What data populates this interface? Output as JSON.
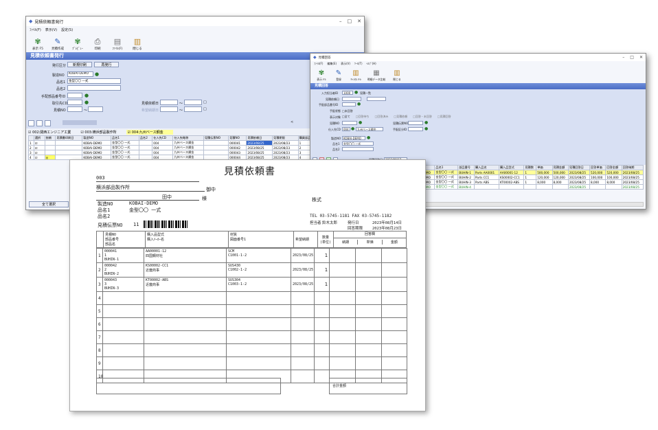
{
  "win1": {
    "title": "見積依頼書発行",
    "menu": [
      "ﾌｧｲﾙ(F)",
      "表示(V)",
      "設定(S)"
    ],
    "tools": [
      {
        "label": "表示 F5",
        "icon": "display-icon"
      },
      {
        "label": "見積作成",
        "icon": "create-icon"
      },
      {
        "label": "ﾌﾟﾚﾋﾞｭｰ",
        "icon": "preview-icon"
      },
      {
        "label": "印刷",
        "icon": "print-icon"
      },
      {
        "label": "ﾌｧｲﾙ(F)",
        "icon": "file-icon"
      },
      {
        "label": "閉じる",
        "icon": "close-icon"
      }
    ],
    "heading": "見積依頼書発行",
    "form": {
      "kind_label": "発行区分",
      "new_btn": "新規印刷",
      "reprint_btn": "再発行",
      "seizo_label": "製造NO",
      "seizo_val": "KOBAI-DEMO",
      "hin1_label": "品名1",
      "hin1_val": "金型〇〇 一式",
      "hin2_label": "品名2",
      "hin2_val": "",
      "tehai_label": "手配部品番号ID",
      "tori_label": "取引先CD",
      "mitsu_label": "見積NO",
      "mdate_label": "見積依頼日",
      "kdate_label": "希望納期日",
      "tilde": "～",
      "cal": "□"
    },
    "filters": [
      {
        "label": "002:関西エンジニア工業",
        "checked": true,
        "hl": false
      },
      {
        "label": "003:横浜部品製作所",
        "checked": true,
        "hl": false
      },
      {
        "label": "004:九州ベース鋼金",
        "checked": true,
        "hl": true
      }
    ],
    "scroll_left": "<",
    "columns": [
      "",
      "選択",
      "依頼",
      "見積書印刷日",
      "製造NO",
      "品名1",
      "品名2",
      "仕入先CD",
      "仕入先略称",
      "見積伝票NO",
      "見積NO",
      "見積依頼日",
      "見積期限",
      "購買部品NO",
      "部品番号",
      "部品名"
    ],
    "rows": [
      {
        "n": "1",
        "sel": "☑",
        "flag": "",
        "date": "",
        "seizo": "KOBAI-DEMO",
        "h1": "金型〇〇 一式",
        "h2": "",
        "cd": "004",
        "name": "九州ベース鋼金",
        "den": "",
        "no": "000041",
        "md": "2023/08/25",
        "kg": "2023/08/23",
        "bno": "1",
        "bb": "1",
        "bname": "BUHIN-1",
        "hl": true
      },
      {
        "n": "2",
        "sel": "☑",
        "flag": "",
        "date": "",
        "seizo": "KOBAI-DEMO",
        "h1": "金型〇〇 一式",
        "h2": "",
        "cd": "004",
        "name": "九州ベース鋼金",
        "den": "",
        "no": "000042",
        "md": "2023/08/25",
        "kg": "2023/08/23",
        "bno": "2",
        "bb": "2",
        "bname": "BUHIN-2",
        "hl": false
      },
      {
        "n": "3",
        "sel": "☑",
        "flag": "",
        "date": "",
        "seizo": "KOBAI-DEMO",
        "h1": "金型〇〇 一式",
        "h2": "",
        "cd": "004",
        "name": "九州ベース鋼金",
        "den": "",
        "no": "000043",
        "md": "2023/08/25",
        "kg": "2023/08/23",
        "bno": "3",
        "bb": "3",
        "bname": "BUHIN-3",
        "hl": false
      },
      {
        "n": "4",
        "sel": "☑",
        "flag": "◎",
        "date": "",
        "seizo": "KOBAI-DEMO",
        "h1": "金型〇〇 一式",
        "h2": "",
        "cd": "004",
        "name": "九州ベース鋼金",
        "den": "",
        "no": "000044",
        "md": "2023/08/25",
        "kg": "2023/08/23",
        "bno": "4",
        "bb": "0",
        "bname": "BUHIN-4",
        "hl": false
      }
    ],
    "select_all": "全て選択"
  },
  "win2": {
    "title": "見積回答",
    "menu": [
      "ﾌｧｲﾙ(F)",
      "編集(E)",
      "表示(V)",
      "ﾂｰﾙ(T)",
      "ﾍﾙﾌﾟ(H)"
    ],
    "tools": [
      {
        "label": "表示 F5",
        "icon": "display-icon"
      },
      {
        "label": "登録",
        "icon": "register-icon"
      },
      {
        "label": "ｷｬﾝｾﾙ F9",
        "icon": "cancel-icon"
      },
      {
        "label": "明細データ比較",
        "icon": "compare-icon"
      },
      {
        "label": "閉じる",
        "icon": "close-icon"
      }
    ],
    "heading": "見積回答",
    "form": {
      "l1": "入力担当者ID",
      "v1": "1000",
      "v1b": "見積一覧",
      "l2": "見積依頼日",
      "l3": "手配部品番号ID",
      "l4": "手配状態",
      "v4": "□未回答",
      "l5": "表示対象",
      "opts": [
        "□全て",
        "□回答待ち",
        "□回答済み",
        "□見積依頼",
        "□回答・未回答",
        "□見積回答"
      ],
      "l6": "見積NO",
      "l6b": "見積伝票NO",
      "l7": "仕入先CD",
      "v7": "004",
      "v7b": "九州ベース鋼金",
      "l7c": "手配区分ID",
      "l8": "製造NO",
      "v8": "KOBAI-DEMO",
      "l9": "品名1",
      "v9": "金型〇〇 一式",
      "l10": "品名2"
    },
    "date_label": "見積回答日",
    "date_val": "2023/08/17",
    "columns": [
      "",
      "見積依頼状況",
      "製番NO",
      "見積NO",
      "仕入先CD",
      "仕入先名",
      "製造NO",
      "品名1",
      "部品番号",
      "購入品名",
      "購入品型式",
      "見積数",
      "単価",
      "見積金額",
      "見積回答日",
      "回答単価",
      "回答金額",
      "回答納期"
    ],
    "rows": [
      {
        "n": "1",
        "st": "回答・未回答",
        "a": "11",
        "no": "000041",
        "b": "九州鋼金",
        "cd": "004",
        "name": "九州ベース鋼金",
        "seizo": "KOBAI-DEMO",
        "h1": "金型〇〇 一式",
        "bb": "BUHIN-1",
        "bn": "Parts AA0001",
        "bk": "AA00001-12",
        "q": "1",
        "u": "500,000",
        "m": "500,000",
        "d": "2023/08/25",
        "ru": "520,000",
        "rm": "520,000",
        "rd": "2023/08/25",
        "hl": true
      },
      {
        "n": "2",
        "st": "回答・未回答",
        "a": "11",
        "no": "000042",
        "b": "九州鋼金",
        "cd": "004",
        "name": "九州ベース鋼金",
        "seizo": "KOBAI-DEMO",
        "h1": "金型〇〇 一式",
        "bb": "BUHIN-2",
        "bn": "Parts CC1",
        "bk": "KS00002-CC1",
        "q": "1",
        "u": "120,000",
        "m": "120,000",
        "d": "2023/08/25",
        "ru": "100,000",
        "rm": "100,000",
        "rd": "2023/08/25",
        "hl": false
      },
      {
        "n": "3",
        "st": "回答・未回答",
        "a": "11",
        "no": "000043",
        "b": "九州鋼金",
        "cd": "004",
        "name": "九州ベース鋼金",
        "seizo": "KOBAI-DEMO",
        "h1": "金型〇〇 一式",
        "bb": "BUHIN-3",
        "bn": "Parts ABS",
        "bk": "KT00002-ABS",
        "q": "1",
        "u": "8,000",
        "m": "8,000",
        "d": "2023/08/25",
        "ru": "8,000",
        "rm": "8,000",
        "rd": "2023/08/25",
        "hl": false
      },
      {
        "n": "4",
        "st": "回答・未回答",
        "a": "11",
        "no": "000044",
        "b": "九州鋼金",
        "cd": "004",
        "name": "九州ベース鋼金",
        "seizo": "KOBAI-DEMO",
        "h1": "金型〇〇 一式",
        "bb": "BUHIN-4",
        "bn": "",
        "bk": "",
        "q": "",
        "u": "",
        "m": "",
        "d": "2023/08/25",
        "ru": "",
        "rm": "",
        "rd": "2023/08/25",
        "hl": false
      }
    ]
  },
  "doc": {
    "title": "見積依頼書",
    "code": "003",
    "vendor": "横浜部品製作所",
    "vendor_suffix": "御中",
    "person": "田中",
    "person_suffix": "様",
    "company": "株式",
    "tel": "TEL 03-5745-1181  FAX 03-5745-1182",
    "tanto_label": "担当者",
    "tanto": "鈴木太郎",
    "issue_label": "発行日",
    "issue": "2023年08月14日",
    "due_label": "回答期限",
    "due": "2023年08月23日",
    "seizo_label": "製造NO",
    "seizo": "KOBAI-DEMO",
    "hin1_label": "品名1",
    "hin1": "金型〇〇 一式",
    "hin2_label": "品名2",
    "den_label": "見積伝票NO",
    "den": "11",
    "headers": {
      "c1a": "見積NO",
      "c1b": "部品番号",
      "c1c": "部品名",
      "c2a": "購入品型式",
      "c2b": "購入ﾒｰｶｰ名",
      "c3a": "材質",
      "c3b": "図面番号1",
      "c4": "希望納期",
      "c5a": "数量",
      "c5b": "(単位)",
      "ans": "回答欄",
      "a1": "納期",
      "a2": "単価",
      "a3": "金額"
    },
    "rows": [
      {
        "n": "1",
        "a": "000041",
        "b": "1",
        "c": "BUHIN-1",
        "m1": "AA00001-12",
        "m2": "四国鋼材社",
        "z1": "SCM",
        "z2": "C1001-1-2",
        "kd": "2023/08/25",
        "q": "1"
      },
      {
        "n": "2",
        "a": "000042",
        "b": "2",
        "c": "BUHIN-2",
        "m1": "KS00002-CC1",
        "m2": "近畿商事",
        "z1": "SUS430",
        "z2": "C1002-1-2",
        "kd": "2023/08/25",
        "q": "1"
      },
      {
        "n": "3",
        "a": "000043",
        "b": "3",
        "c": "BUHIN-3",
        "m1": "KT00002-ABS",
        "m2": "近畿商事",
        "z1": "SUS304",
        "z2": "C1003-1-2",
        "kd": "2023/08/25",
        "q": "1"
      },
      {
        "n": "4",
        "a": "",
        "b": "",
        "c": "",
        "m1": "",
        "m2": "",
        "z1": "",
        "z2": "",
        "kd": "",
        "q": ""
      },
      {
        "n": "5",
        "a": "",
        "b": "",
        "c": "",
        "m1": "",
        "m2": "",
        "z1": "",
        "z2": "",
        "kd": "",
        "q": ""
      },
      {
        "n": "6",
        "a": "",
        "b": "",
        "c": "",
        "m1": "",
        "m2": "",
        "z1": "",
        "z2": "",
        "kd": "",
        "q": ""
      },
      {
        "n": "7",
        "a": "",
        "b": "",
        "c": "",
        "m1": "",
        "m2": "",
        "z1": "",
        "z2": "",
        "kd": "",
        "q": ""
      },
      {
        "n": "8",
        "a": "",
        "b": "",
        "c": "",
        "m1": "",
        "m2": "",
        "z1": "",
        "z2": "",
        "kd": "",
        "q": ""
      },
      {
        "n": "9",
        "a": "",
        "b": "",
        "c": "",
        "m1": "",
        "m2": "",
        "z1": "",
        "z2": "",
        "kd": "",
        "q": ""
      },
      {
        "n": "10",
        "a": "",
        "b": "",
        "c": "",
        "m1": "",
        "m2": "",
        "z1": "",
        "z2": "",
        "kd": "",
        "q": ""
      }
    ],
    "total_label": "合計金額"
  },
  "colors": {
    "title_bar": "#5577cc",
    "form_bg": "#d8e0f3",
    "highlight": "#ffff99",
    "selected": "#3366cc"
  }
}
